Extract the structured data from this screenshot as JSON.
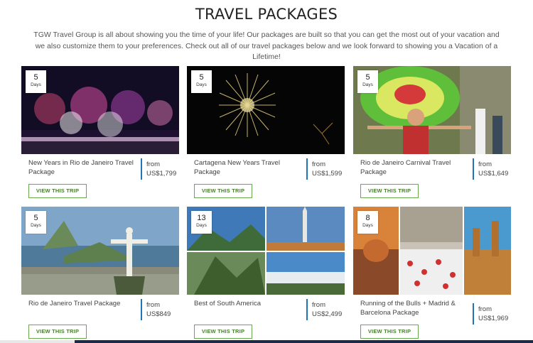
{
  "header": {
    "title": "TRAVEL PACKAGES",
    "intro": "TGW Travel Group is all about showing you the time of your life! Our packages are built so that you can get the most out of your vacation and we also customize them to your preferences. Check out all of our travel packages below and we look forward to showing you a Vacation of a Lifetime!"
  },
  "packages": [
    {
      "days": "5",
      "days_label": "Days",
      "name": "New Years in Rio de Janeiro Travel Package",
      "from": "from",
      "price": "US$1,799",
      "button": "VIEW THIS TRIP"
    },
    {
      "days": "5",
      "days_label": "Days",
      "name": "Cartagena New Years Travel Package",
      "from": "from",
      "price": "US$1,599",
      "button": "VIEW THIS TRIP"
    },
    {
      "days": "5",
      "days_label": "Days",
      "name": "Rio de Janeiro Carnival Travel Package",
      "from": "from",
      "price": "US$1,649",
      "button": "VIEW THIS TRIP"
    },
    {
      "days": "5",
      "days_label": "Days",
      "name": "Rio de Janeiro Travel Package",
      "from": "from",
      "price": "US$849",
      "button": "VIEW THIS TRIP"
    },
    {
      "days": "13",
      "days_label": "Days",
      "name": "Best of South America",
      "from": "from",
      "price": "US$2,499",
      "button": "VIEW THIS TRIP"
    },
    {
      "days": "8",
      "days_label": "Days",
      "name": "Running of the Bulls + Madrid & Barcelona Package",
      "from": "from",
      "price": "US$1,969",
      "button": "VIEW THIS TRIP"
    }
  ],
  "colors": {
    "accent_blue": "#1f75b5",
    "button_green": "#6aa84f",
    "footer_navy": "#1c2a4a"
  }
}
